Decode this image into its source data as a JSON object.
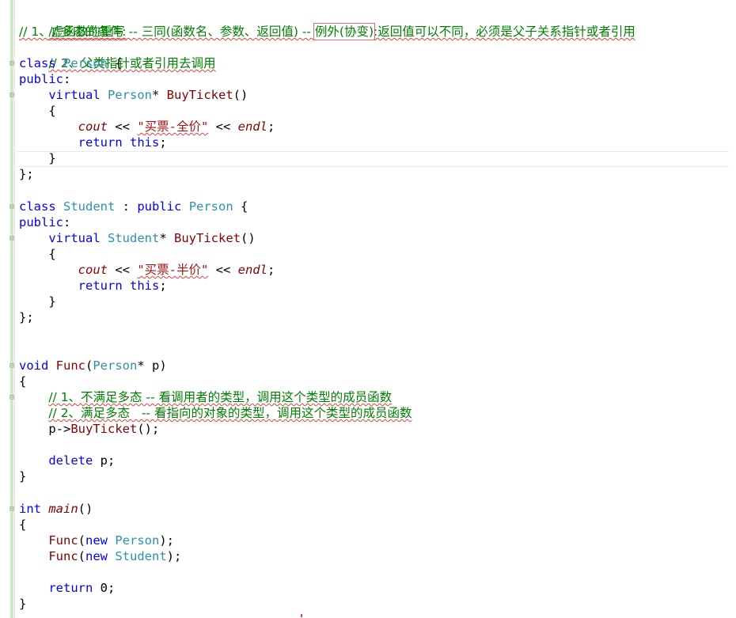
{
  "editor": {
    "comments": {
      "c1": "// 多态的条件:",
      "c2_a": "// 1、虚函数的重写 -- 三同(函数名、参数、返回值) -- ",
      "c2_box": "例外(协变)",
      "c2_b": ":返回值可以不同，必须是父子关系指针或者引用",
      "c3": "// 2、父类指针或者引用去调用",
      "func_c1": "// 1、不满足多态 -- 看调用者的类型，调用这个类型的成员函数",
      "func_c2": "// 2、满足多态   -- 看指向的对象的类型，调用这个类型的成员函数"
    },
    "tokens": {
      "class": "class",
      "public": "public",
      "virtual": "virtual",
      "return": "return",
      "this": "this",
      "void": "void",
      "int": "int",
      "new": "new",
      "delete": "delete",
      "person": "Person",
      "student": "Student",
      "buyticket": "BuyTicket",
      "cout": "cout",
      "endl": "endl",
      "func": "Func",
      "main": "main",
      "str_person": "\"买票-全价\"",
      "str_student": "\"买票-半价\"",
      "zero": "0"
    }
  }
}
